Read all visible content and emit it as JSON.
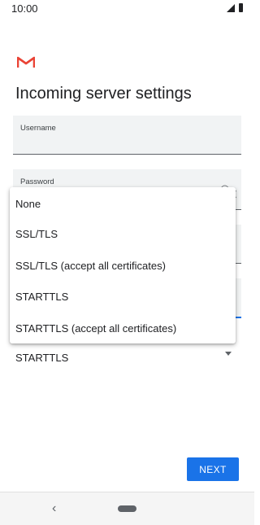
{
  "status": {
    "time": "10:00",
    "icons": [
      "signal-icon",
      "battery-icon"
    ]
  },
  "app": {
    "logo": "gmail-logo",
    "title": "Incoming server settings"
  },
  "fields": {
    "username_label": "Username",
    "password_label": "Password",
    "security_type_value": "STARTTLS"
  },
  "dropdown": {
    "options": [
      "None",
      "SSL/TLS",
      "SSL/TLS (accept all certificates)",
      "STARTTLS",
      "STARTTLS (accept all certificates)"
    ]
  },
  "buttons": {
    "next_label": "NEXT"
  },
  "colors": {
    "accent": "#1a73e8",
    "gmail_red": "#ea4335"
  }
}
